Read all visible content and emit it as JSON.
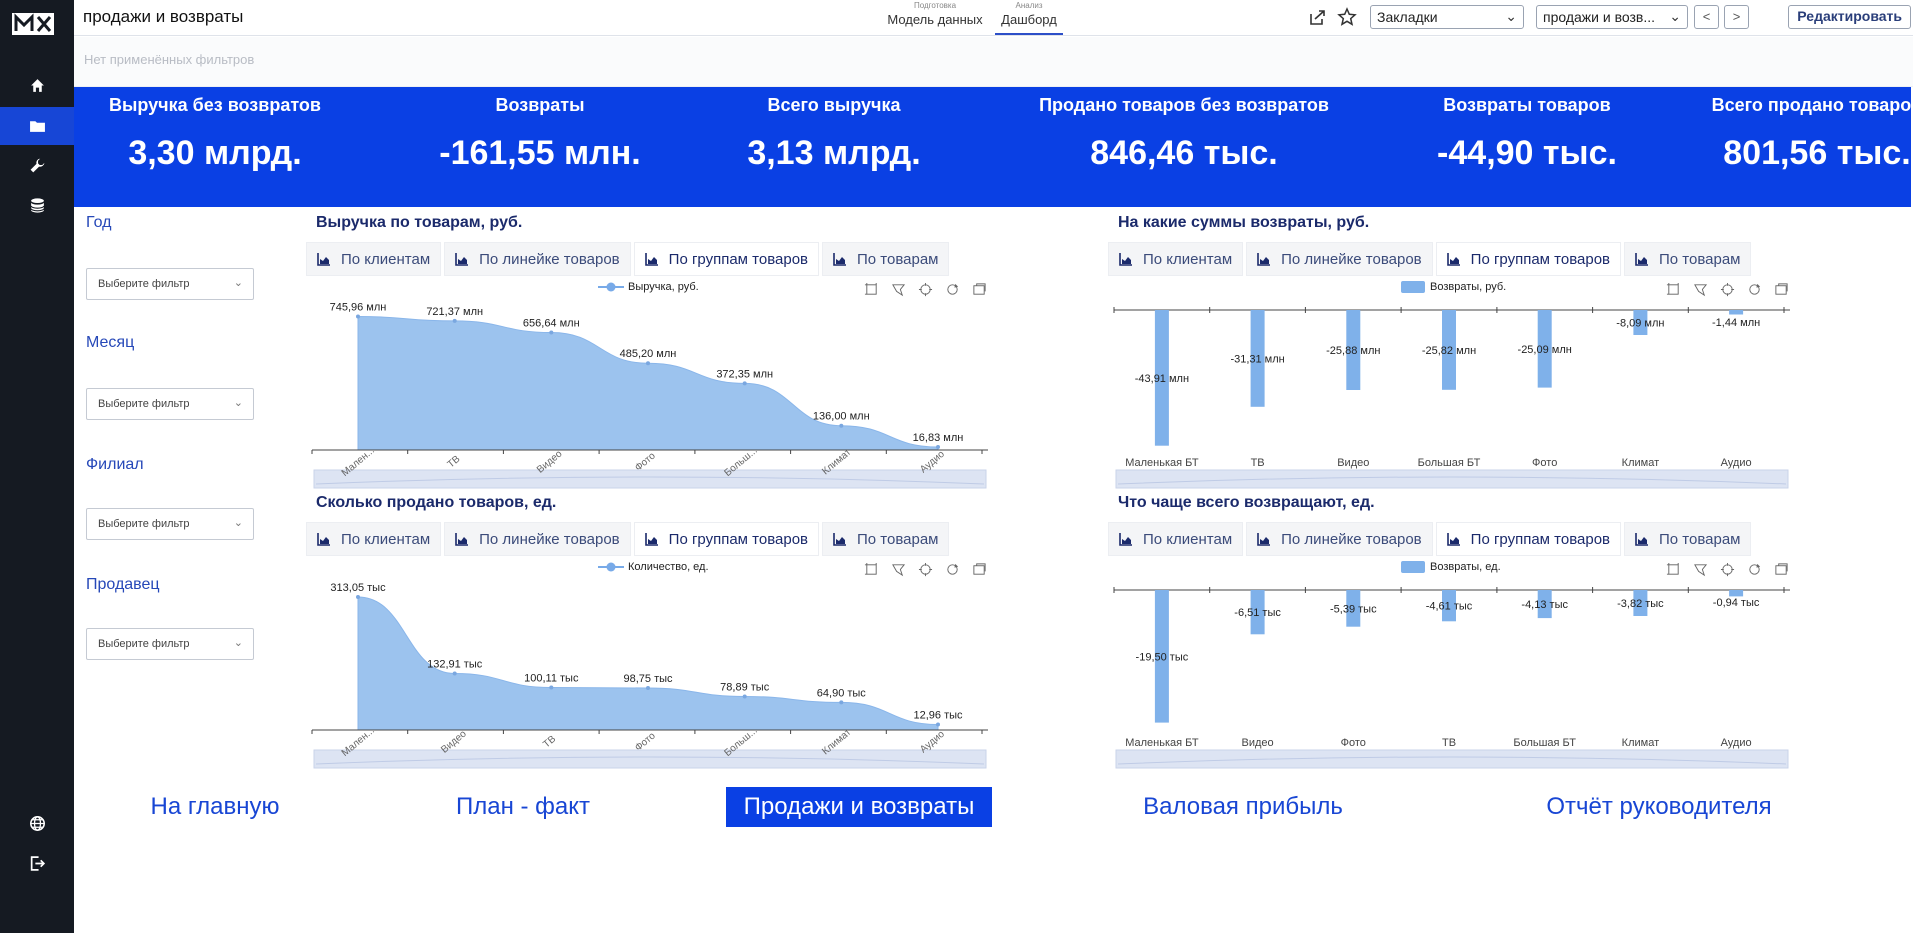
{
  "app": {
    "title": "продажи и возвраты",
    "mode_tabs": [
      {
        "small": "Подготовка",
        "label": "Модель данных"
      },
      {
        "small": "Анализ",
        "label": "Дашборд"
      }
    ],
    "bookmarks_select": "Закладки",
    "sheet_select": "продажи и возв...",
    "prev": "<",
    "next": ">",
    "edit_label": "Редактировать",
    "filters_status": "Нет применённых фильтров"
  },
  "sidebar": {
    "icons": [
      "logo",
      "home-icon",
      "folder-icon",
      "wrench-icon",
      "database-icon",
      "globe-icon",
      "logout-icon"
    ]
  },
  "kpis": [
    {
      "title": "Выручка без возвратов",
      "value": "3,30 млрд."
    },
    {
      "title": "Возвраты",
      "value": "-161,55 млн."
    },
    {
      "title": "Всего выручка",
      "value": "3,13 млрд."
    },
    {
      "title": "Продано товаров без возвратов",
      "value": "846,46 тыс."
    },
    {
      "title": "Возвраты товаров",
      "value": "-44,90 тыс."
    },
    {
      "title": "Всего продано товаров",
      "value": "801,56 тыс."
    }
  ],
  "filters": [
    {
      "label": "Год",
      "placeholder": "Выберите фильтр"
    },
    {
      "label": "Месяц",
      "placeholder": "Выберите фильтр"
    },
    {
      "label": "Филиал",
      "placeholder": "Выберите фильтр"
    },
    {
      "label": "Продавец",
      "placeholder": "Выберите фильтр"
    }
  ],
  "tab_labels": [
    "По клиентам",
    "По линейке товаров",
    "По группам товаров",
    "По товарам"
  ],
  "colors": {
    "kpi_bg": "#0a40e4",
    "area_fill": "#9cc3ee",
    "bar_fill": "#7fb1ea",
    "accent": "#1846d4"
  },
  "chart_data": [
    {
      "type": "area",
      "title": "Выручка по товарам, руб.",
      "legend": "Выручка, руб.",
      "categories": [
        "Мален...",
        "ТВ",
        "Видео",
        "Фото",
        "Больш...",
        "Климат",
        "Аудио"
      ],
      "values": [
        745.96,
        721.37,
        656.64,
        485.2,
        372.35,
        136.0,
        16.83
      ],
      "labels": [
        "745,96 млн",
        "721,37 млн",
        "656,64 млн",
        "485,20 млн",
        "372,35 млн",
        "136,00 млн",
        "16,83 млн"
      ],
      "ylim": [
        0,
        760
      ]
    },
    {
      "type": "bar",
      "title": "На какие суммы возвраты, руб.",
      "legend": "Возвраты, руб.",
      "categories": [
        "Маленькая БТ",
        "ТВ",
        "Видео",
        "Большая БТ",
        "Фото",
        "Климат",
        "Аудио"
      ],
      "values": [
        -43.91,
        -31.31,
        -25.88,
        -25.82,
        -25.09,
        -8.09,
        -1.44
      ],
      "labels": [
        "-43,91 млн",
        "-31,31 млн",
        "-25,88 млн",
        "-25,82 млн",
        "-25,09 млн",
        "-8,09 млн",
        "-1,44 млн"
      ],
      "ylim": [
        -44,
        0
      ]
    },
    {
      "type": "area",
      "title": "Сколько продано товаров, ед.",
      "legend": "Количество, ед.",
      "categories": [
        "Мален...",
        "Видео",
        "ТВ",
        "Фото",
        "Больш...",
        "Климат",
        "Аудио"
      ],
      "values": [
        313.05,
        132.91,
        100.11,
        98.75,
        78.89,
        64.9,
        12.96
      ],
      "labels": [
        "313,05 тыс",
        "132,91 тыс",
        "100,11 тыс",
        "98,75 тыс",
        "78,89 тыс",
        "64,90 тыс",
        "12,96 тыс"
      ],
      "ylim": [
        0,
        320
      ]
    },
    {
      "type": "bar",
      "title": "Что чаще всего возвращают, ед.",
      "legend": "Возвраты, ед.",
      "categories": [
        "Маленькая БТ",
        "Видео",
        "Фото",
        "ТВ",
        "Большая БТ",
        "Климат",
        "Аудио"
      ],
      "values": [
        -19.5,
        -6.51,
        -5.39,
        -4.61,
        -4.13,
        -3.82,
        -0.94
      ],
      "labels": [
        "-19,50 тыс",
        "-6,51 тыс",
        "-5,39 тыс",
        "-4,61 тыс",
        "-4,13 тыс",
        "-3,82 тыс",
        "-0,94 тыс"
      ],
      "ylim": [
        -20,
        0
      ]
    }
  ],
  "bottom_nav": [
    {
      "label": "На главную"
    },
    {
      "label": "План - факт"
    },
    {
      "label": "Продажи и возвраты"
    },
    {
      "label": "Валовая прибыль"
    },
    {
      "label": "Отчёт руководителя"
    }
  ]
}
